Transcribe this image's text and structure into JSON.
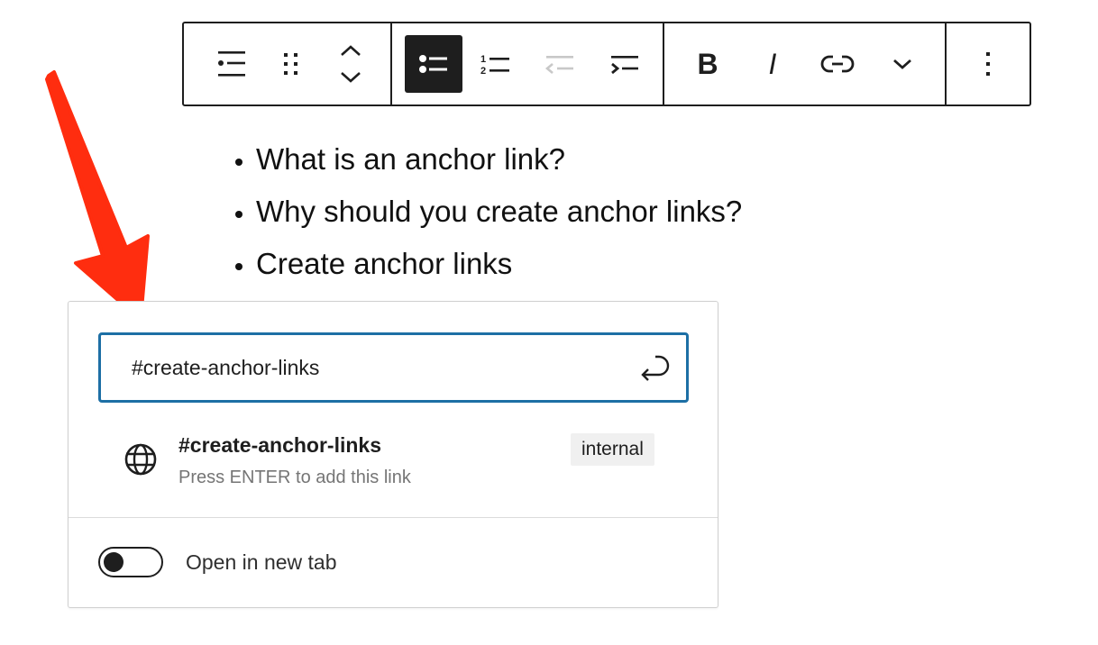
{
  "toolbar": {
    "groups": [
      {
        "name": "block",
        "buttons": [
          {
            "icon": "list-block-icon",
            "label": "List"
          },
          {
            "icon": "drag-handle-icon",
            "label": "Drag"
          },
          {
            "icon": "move-up-icon",
            "label": "Move up"
          },
          {
            "icon": "move-down-icon",
            "label": "Move down"
          }
        ]
      },
      {
        "name": "list-format",
        "buttons": [
          {
            "icon": "unordered-list-icon",
            "label": "Unordered list",
            "active": true
          },
          {
            "icon": "ordered-list-icon",
            "label": "Ordered list"
          },
          {
            "icon": "outdent-icon",
            "label": "Outdent",
            "disabled": true
          },
          {
            "icon": "indent-icon",
            "label": "Indent"
          }
        ]
      },
      {
        "name": "text-format",
        "buttons": [
          {
            "icon": "bold-icon",
            "label": "Bold",
            "glyph": "B"
          },
          {
            "icon": "italic-icon",
            "label": "Italic",
            "glyph": "I"
          },
          {
            "icon": "link-icon",
            "label": "Link"
          },
          {
            "icon": "chevron-down-icon",
            "label": "More"
          }
        ]
      },
      {
        "name": "options",
        "buttons": [
          {
            "icon": "more-vertical-icon",
            "label": "Options"
          }
        ]
      }
    ]
  },
  "content": {
    "list_items": [
      "What is an anchor link?",
      "Why should you create anchor links?",
      "Create anchor links"
    ]
  },
  "link_popover": {
    "input_value": "#create-anchor-links",
    "suggestion": {
      "title": "#create-anchor-links",
      "subtitle": "Press ENTER to add this link",
      "badge": "internal"
    },
    "toggle": {
      "label": "Open in new tab",
      "checked": false
    }
  },
  "colors": {
    "accent": "#1d6fa5",
    "arrow": "#ff2d0f",
    "text": "#1e1e1e",
    "muted": "#757575"
  }
}
